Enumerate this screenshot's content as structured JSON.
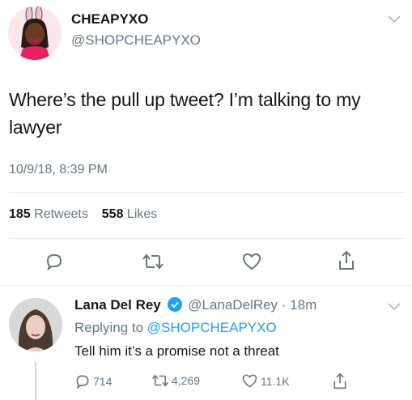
{
  "main_tweet": {
    "display_name": "CHEAPYXO",
    "handle": "@SHOPCHEAPYXO",
    "text": "Where’s the pull up tweet? I’m talking to my lawyer",
    "timestamp": "10/9/18, 8:39 PM",
    "stats": {
      "retweets_count": "185",
      "retweets_label": "Retweets",
      "likes_count": "558",
      "likes_label": "Likes"
    }
  },
  "reply_tweet": {
    "display_name": "Lana Del Rey",
    "verified": true,
    "handle_time": "@LanaDelRey · 18m",
    "replying_prefix": "Replying to",
    "replying_to": "@SHOPCHEAPYXO",
    "text": "Tell him it’s a promise not a threat",
    "actions": {
      "replies": "714",
      "retweets": "4,269",
      "likes": "11.1K"
    }
  },
  "icons": [
    "chevron-down",
    "reply",
    "retweet",
    "like",
    "share",
    "verified-badge"
  ],
  "colors": {
    "text": "#14171a",
    "muted": "#657786",
    "link": "#1da1f2",
    "divider": "#e6ecf0"
  }
}
